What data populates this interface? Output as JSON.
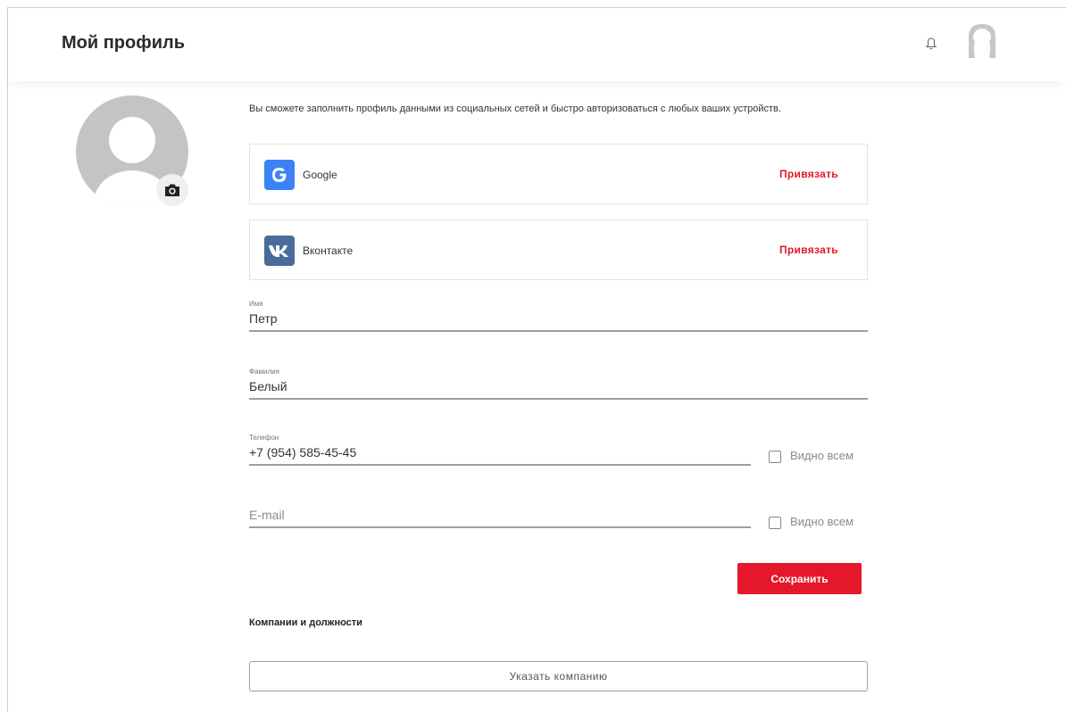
{
  "header": {
    "title": "Мой профиль",
    "bell_icon": "bell-icon",
    "avatar_icon": "user-avatar-icon"
  },
  "profile": {
    "avatar_icon": "user-silhouette-icon",
    "photo_button_icon": "camera-icon"
  },
  "intro_text": "Вы сможете заполнить профиль данными из социальных сетей и быстро авторизоваться с любых ваших устройств.",
  "socials": [
    {
      "icon": "google-icon",
      "name": "Google",
      "action": "Привязать",
      "color": "#3b82f6"
    },
    {
      "icon": "vk-icon",
      "name": "Вконтакте",
      "action": "Привязать",
      "color": "#4a6c9b"
    }
  ],
  "form": {
    "first_name": {
      "label": "Имя",
      "value": "Петр"
    },
    "last_name": {
      "label": "Фамилия",
      "value": "Белый"
    },
    "phone": {
      "label": "Телефон",
      "value": "+7 (954) 585-45-45",
      "visibility_label": "Видно всем",
      "visible": false
    },
    "email": {
      "placeholder": "E-mail",
      "value": "",
      "visibility_label": "Видно всем",
      "visible": false
    },
    "save_label": "Сохранить"
  },
  "companies": {
    "title": "Компании и должности",
    "add_label": "Указать компанию"
  },
  "colors": {
    "accent": "#e5172b",
    "avatar_gray": "#c4c4c4"
  }
}
